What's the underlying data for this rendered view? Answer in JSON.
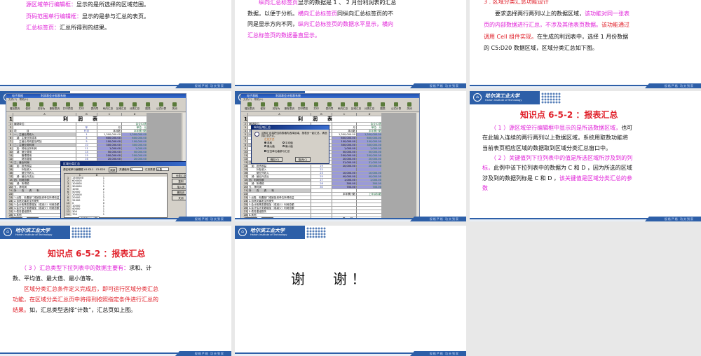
{
  "footer_text": "规格严格 功夫到家",
  "logo": {
    "cn": "哈尔滨工业大学",
    "en": "Harbin Institute of Technology"
  },
  "slide1": {
    "lines": [
      [
        {
          "t": "源区域单行编辑框：",
          "c": "m"
        },
        {
          "t": "显示的是所选择的区域范围。",
          "c": ""
        }
      ],
      [
        {
          "t": "页码范围单行编辑框：",
          "c": "m"
        },
        {
          "t": "显示的是参与汇总的表页。",
          "c": ""
        }
      ],
      [
        {
          "t": "汇总标签页：",
          "c": "m"
        },
        {
          "t": "汇总所得到的结果。",
          "c": ""
        }
      ]
    ]
  },
  "slide2": {
    "lines": [
      [
        {
          "t": "　　纵向汇总标签页",
          "c": "m"
        },
        {
          "t": "显示的数据是 1 、 2 月份利润表的汇总",
          "c": ""
        }
      ],
      [
        {
          "t": "数据，以便于分析。",
          "c": ""
        },
        {
          "t": "横向汇总标签页",
          "c": "m"
        },
        {
          "t": "同纵向汇总标签页的不",
          "c": ""
        }
      ],
      [
        {
          "t": "同是显示方向不同，",
          "c": ""
        },
        {
          "t": "纵向汇总标签页的数据水平显示，横向",
          "c": "m"
        }
      ],
      [
        {
          "t": "汇总标签页的数据垂直显示。",
          "c": "m"
        }
      ]
    ]
  },
  "slide3": {
    "lines": [
      [
        {
          "t": "3 . 区域分类汇总功能设计",
          "c": "r"
        }
      ],
      [
        {
          "t": "　　要求选择两行两列以上的数据区域，",
          "c": ""
        },
        {
          "t": "该功能对同一张表",
          "c": "m"
        }
      ],
      [
        {
          "t": "页的内部数据进行汇总，不涉及其他表页数据。",
          "c": "m"
        },
        {
          "t": "该功能通过",
          "c": "r"
        }
      ],
      [
        {
          "t": "调用 Cell 组件实现。",
          "c": "r"
        },
        {
          "t": "在生成的利润表中，选择 1 月份数据",
          "c": ""
        }
      ],
      [
        {
          "t": "的 C5:D20 数据区域，区域分类汇总如下图。",
          "c": ""
        }
      ]
    ]
  },
  "slide6": {
    "title": "知识点 6-5-2 ：报表汇总",
    "lines": [
      [
        {
          "t": "　　（ 1 ）源区域单行编辑框中显示的是所选数据区域，",
          "c": "m"
        },
        {
          "t": "也可",
          "c": ""
        }
      ],
      [
        {
          "t": "在此输入连续的两行两列以上数据区域，系统用取数功能将",
          "c": ""
        }
      ],
      [
        {
          "t": "当前表页相应区域的数据取到区域分类汇总窗口中。",
          "c": ""
        }
      ],
      [
        {
          "t": "　　（ 2 ）关键值列下拉列表中的值是所选区域所涉及到的列",
          "c": "m"
        }
      ],
      [
        {
          "t": "标，",
          "c": "m"
        },
        {
          "t": "此例中该下拉列表中的数据为 C 和 D ，因为所选的区域",
          "c": ""
        }
      ],
      [
        {
          "t": "涉及到的数据列标是 C 和 D ，",
          "c": ""
        },
        {
          "t": "该关键值是区域分类汇总的参",
          "c": "m"
        }
      ],
      [
        {
          "t": "数",
          "c": "m"
        }
      ]
    ]
  },
  "slide7": {
    "title": "知识点 6-5-2 ：报表汇总",
    "lines": [
      [
        {
          "t": "　　（ 3 ）汇总类型下拉列表中的数据主要有：",
          "c": "m"
        },
        {
          "t": "求和、计",
          "c": ""
        }
      ],
      [
        {
          "t": "数、平均值、最大值、最小值等。",
          "c": ""
        }
      ],
      [
        {
          "t": "　　区域分类汇总条件定义完成后，即可运行区域分类汇总",
          "c": "r"
        }
      ],
      [
        {
          "t": "功能，在区域分类汇总页中将得到按照指定条件进行汇总的",
          "c": "r"
        }
      ],
      [
        {
          "t": "结果。",
          "c": "r"
        },
        {
          "t": "如，汇总类型选择“计数”，汇总页如上图。",
          "c": ""
        }
      ]
    ]
  },
  "slide8": {
    "text": "谢　　谢 ！"
  },
  "app": {
    "title": "电子表格",
    "doc_title": "利润表会计报表系统",
    "menu": "文件(F)　帮助(H)",
    "tools": [
      "增加表页",
      "保存",
      "另存为",
      "删除表页",
      "打印预览",
      "打印",
      "表向导",
      "纵向汇总",
      "区域汇总",
      "分类汇总",
      "图表",
      "公式计算",
      "关闭"
    ],
    "cols": [
      "A",
      "B",
      "C",
      "D"
    ],
    "rows": [
      [
        "利　　润　　表",
        "",
        "",
        ""
      ],
      [
        "编制单位：",
        "",
        "",
        "会企02表"
      ],
      [
        "",
        "年",
        "月",
        "单位：元"
      ],
      [
        "项　　　　目",
        "行次",
        "本月数",
        "本年累计数"
      ],
      [
        "一、主营业务收入",
        "1",
        "1,300,000.00",
        "1,300,000.00"
      ],
      [
        "　减：主营业务成本",
        "4",
        "600,000.00",
        "600,000.00"
      ],
      [
        "　　主营业务税金及附加",
        "5",
        "100,000.00",
        "100,000.00"
      ],
      [
        "二、主营业务利润",
        "10",
        "300,000.00",
        "300,000.00"
      ],
      [
        "　加：其他业务利润",
        "11",
        "1,000.00",
        "1,000.00"
      ],
      [
        "　减：营业费用",
        "14",
        "50,000.00",
        "50,000.00"
      ],
      [
        "　　　管理费用",
        "15",
        "200,000.00",
        "200,000.00"
      ],
      [
        "　　　财务费用",
        "16",
        "20,000.00",
        "20,000.00"
      ],
      [
        "三、营业利润",
        "18",
        "31,000.00",
        "31,000.00"
      ],
      [
        "　加：投资收益",
        "19",
        "20,000.00",
        "20,000.00"
      ],
      [
        "　　　补贴收入",
        "22",
        "",
        ""
      ],
      [
        "　　　营业外收入",
        "23",
        "10,000.00",
        "10,000.00"
      ],
      [
        "　减：营业外支出",
        "25",
        "40,000.00",
        "40,000.00"
      ],
      [
        "四、利润总额",
        "27",
        "1,000.00",
        "1,000.00"
      ],
      [
        "　减：所得税",
        "28",
        "300.00",
        "300.00"
      ],
      [
        "五、净利润",
        "30",
        "700.00",
        "700.00"
      ],
      [
        "补　　充　　资　　料",
        "",
        "",
        ""
      ],
      [
        "",
        "",
        "本年累计数",
        "上年实际数"
      ],
      [
        "1.出售、处置部门或被投资单位所得收益",
        "",
        "",
        ""
      ],
      [
        "2.自然灾害发生的损失",
        "",
        "",
        ""
      ],
      [
        "3.会计政策变更增加（或减少）利润总额",
        "",
        "",
        ""
      ],
      [
        "4.会计估计变更增加（或减少）利润总额",
        "",
        "",
        ""
      ],
      [
        "5.债务重组损失",
        "",
        "",
        ""
      ],
      [
        "6.其他",
        "",
        "",
        ""
      ],
      [
        "　　制　　表：",
        "",
        "复　　核：",
        ""
      ],
      [
        "　　财务主管：",
        "",
        "报送日期：",
        ""
      ]
    ],
    "sheet_tabs": [
      "利润表",
      "利润表"
    ],
    "region_dialog": {
      "title": "区域分类汇总",
      "source_label": "源区域单行编辑框 A1:D11　C5:D20",
      "refresh": "刷新",
      "key_label": "关键值列",
      "key_value": "C",
      "type_label": "汇总类型",
      "type_value": "计数",
      "buttons": [
        "分类汇总",
        "复制",
        "插入页",
        "删除页",
        "关闭"
      ],
      "tab": "汇总页(1)-计数",
      "list_cols": [
        "C",
        "D"
      ],
      "list": [
        [
          "1300000",
          "1"
        ],
        [
          "600000",
          "1"
        ],
        [
          "100000",
          "1"
        ],
        [
          "300000",
          "1"
        ],
        [
          "1000",
          "2"
        ],
        [
          "50000",
          "1"
        ],
        [
          "200000",
          "1"
        ],
        [
          "20000",
          "2"
        ],
        [
          "31000",
          "1"
        ],
        [
          "0",
          "0"
        ],
        [
          "10000",
          "1"
        ],
        [
          "40000",
          "1"
        ],
        [
          "300",
          "1"
        ],
        [
          "700",
          "1"
        ]
      ]
    },
    "vertical_dialog": {
      "title": "纵向区域汇总",
      "msg": "这种汇总将把当前表格内选择区域，按表页一起汇总，请选择汇总方式。",
      "group": "汇总方式",
      "options": [
        "求和",
        "平均值",
        "最大值",
        "最小值"
      ],
      "checkbox": "空白单元格参与汇总",
      "ok": "确定(O)",
      "cancel": "取消(C)"
    }
  }
}
